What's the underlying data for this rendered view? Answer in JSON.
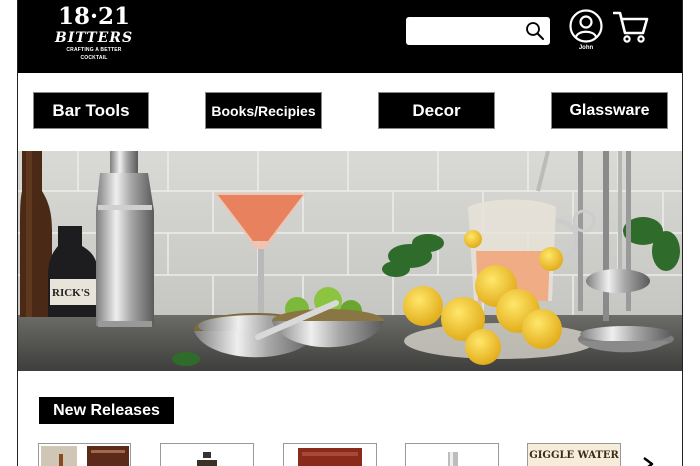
{
  "header": {
    "logo": {
      "number": "18·21",
      "name": "BITTERS",
      "tagline": "CRAFTING A BETTER COCKTAIL"
    },
    "search": {
      "value": "",
      "placeholder": ""
    },
    "account": {
      "username": "John"
    }
  },
  "nav": {
    "items": [
      {
        "label": "Bar Tools"
      },
      {
        "label": "Books/Recipies"
      },
      {
        "label": "Decor"
      },
      {
        "label": "Glassware"
      }
    ]
  },
  "hero": {
    "bottle_label": "RICK'S"
  },
  "new_releases": {
    "title": "New Releases",
    "products": [
      {
        "label": ""
      },
      {
        "label": ""
      },
      {
        "label": ""
      },
      {
        "label": ""
      },
      {
        "label": "GIGGLE WATER"
      }
    ]
  },
  "colors": {
    "header_bg": "#000000",
    "button_bg": "#000000",
    "button_text": "#ffffff",
    "page_bg": "#ffffff"
  }
}
